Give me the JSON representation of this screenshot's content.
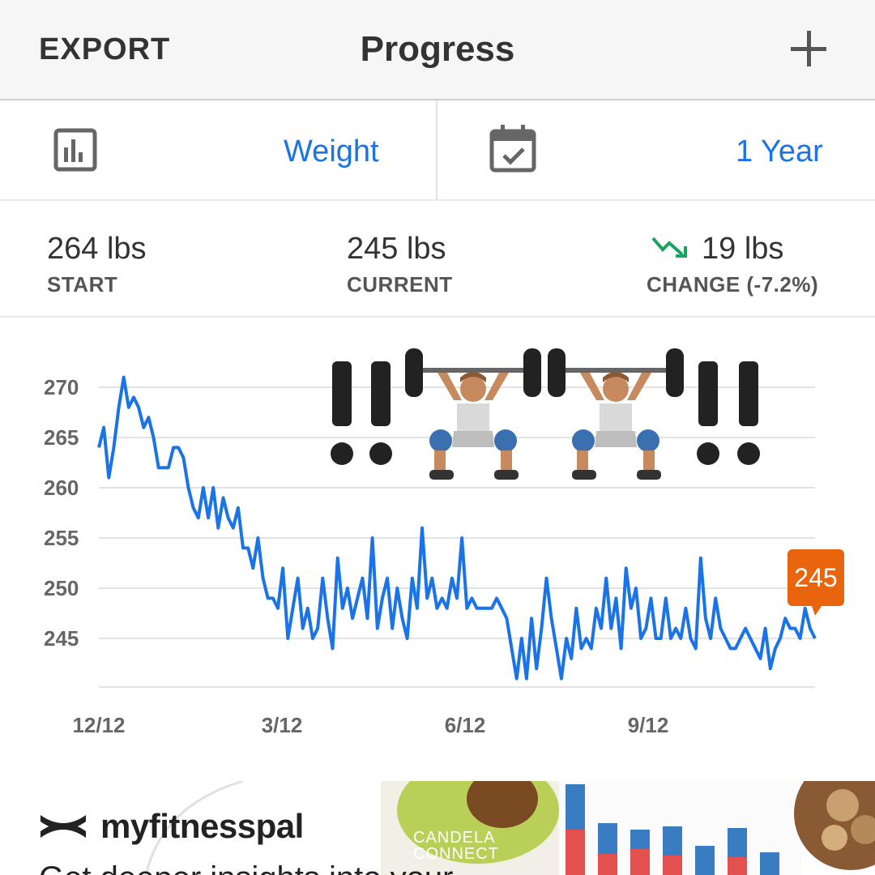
{
  "header": {
    "export_label": "EXPORT",
    "title": "Progress",
    "add_icon": "plus-icon"
  },
  "selectors": {
    "metric": {
      "icon": "bar-chart-icon",
      "label": "Weight"
    },
    "range": {
      "icon": "calendar-check-icon",
      "label": "1 Year"
    }
  },
  "stats": {
    "start": {
      "value": "264 lbs",
      "label": "START"
    },
    "current": {
      "value": "245 lbs",
      "label": "CURRENT"
    },
    "change": {
      "value": "19 lbs",
      "label": "CHANGE (-7.2%)",
      "icon": "trending-down-icon",
      "icon_color": "#1aa260"
    }
  },
  "chart_data": {
    "type": "line",
    "title": "",
    "xlabel": "",
    "ylabel": "",
    "ylim": [
      240,
      272
    ],
    "y_ticks": [
      "270",
      "265",
      "260",
      "255",
      "250",
      "245"
    ],
    "x_ticks": [
      "12/12",
      "3/12",
      "6/12",
      "9/12"
    ],
    "grid": true,
    "line_color": "#1a73e8",
    "latest_badge": {
      "label": "245",
      "color": "#e8650e"
    },
    "series": [
      {
        "values": [
          264,
          266,
          261,
          264,
          268,
          271,
          268,
          269,
          268,
          266,
          267,
          265,
          262,
          262,
          262,
          264,
          264,
          263,
          260,
          258,
          257,
          260,
          257,
          260,
          256,
          259,
          257,
          256,
          258,
          254,
          254,
          252,
          255,
          251,
          249,
          249,
          248,
          252,
          245,
          248,
          251,
          246,
          248,
          245,
          246,
          251,
          247,
          244,
          253,
          248,
          250,
          247,
          249,
          251,
          247,
          255,
          246,
          249,
          251,
          246,
          250,
          247,
          245,
          251,
          248,
          256,
          249,
          251,
          248,
          249,
          248,
          251,
          249,
          255,
          248,
          249,
          248,
          248,
          248,
          248,
          249,
          248,
          247,
          244,
          241,
          245,
          241,
          247,
          242,
          246,
          251,
          247,
          244,
          241,
          245,
          243,
          248,
          244,
          245,
          244,
          248,
          246,
          251,
          246,
          249,
          244,
          252,
          248,
          250,
          245,
          246,
          249,
          245,
          245,
          249,
          245,
          246,
          245,
          248,
          245,
          244,
          253,
          247,
          245,
          249,
          246,
          245,
          244,
          244,
          245,
          246,
          245,
          244,
          243,
          246,
          242,
          244,
          245,
          247,
          246,
          246,
          245,
          248,
          246,
          245
        ],
        "x_fraction_note_removed": true
      }
    ]
  },
  "decoration": {
    "emoji_text": "‼️🏋🏽‍♂️🏋🏽‍♂️‼️"
  },
  "ad": {
    "brand_icon": "under-armour-logo-icon",
    "brand": "myfitnesspal",
    "sponsor_line1": "CANDELA",
    "sponsor_line2": "CONNECT",
    "tagline": "Get deeper insights into your"
  }
}
